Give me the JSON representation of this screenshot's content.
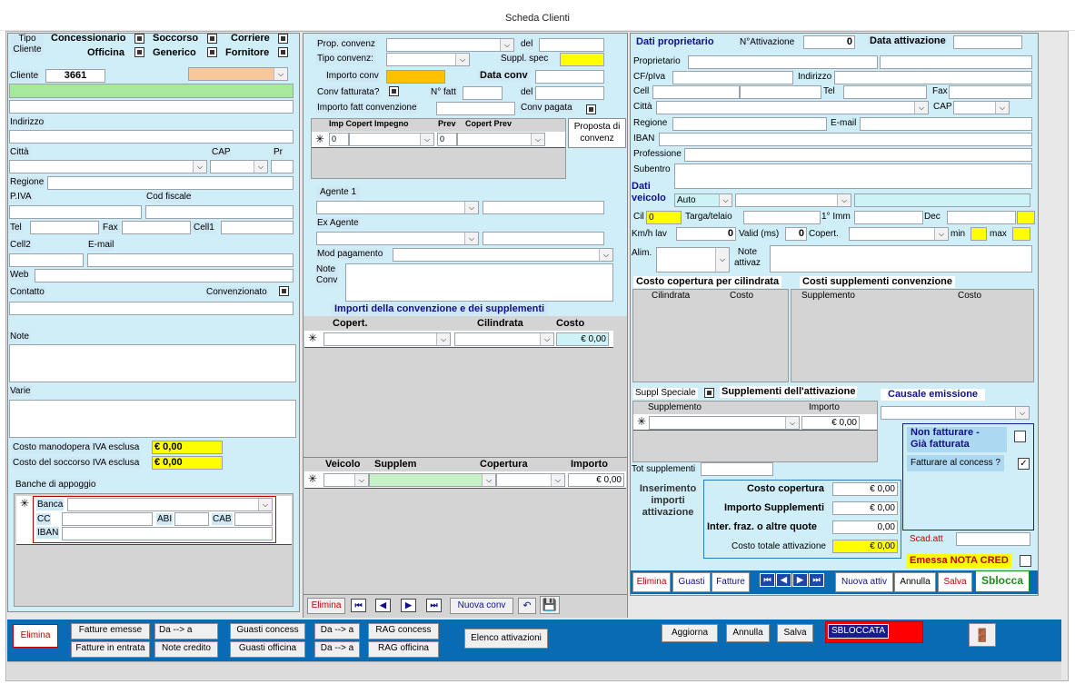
{
  "window": {
    "title": "Scheda Clienti"
  },
  "left": {
    "tipo_cliente_label": "Tipo\nCliente",
    "tipo_opts": [
      "Concessionario",
      "Soccorso",
      "Corriere",
      "Officina",
      "Generico",
      "Fornitore"
    ],
    "cliente_label": "Cliente",
    "cliente_value": "3661",
    "indirizzo": "Indirizzo",
    "citta": "Città",
    "cap": "CAP",
    "pr": "Pr",
    "regione": "Regione",
    "piva": "P.IVA",
    "cod_fiscale": "Cod fiscale",
    "tel": "Tel",
    "fax": "Fax",
    "cell1": "Cell1",
    "cell2": "Cell2",
    "email": "E-mail",
    "web": "Web",
    "contatto": "Contatto",
    "convenzionato": "Convenzionato",
    "note": "Note",
    "varie": "Varie",
    "costo_manodopera": "Costo manodopera IVA esclusa",
    "costo_manodopera_value": "€ 0,00",
    "costo_soccorso": "Costo del soccorso IVA esclusa",
    "costo_soccorso_value": "€ 0,00",
    "banche": "Banche di appoggio",
    "banca": "Banca",
    "cc": "CC",
    "abi": "ABI",
    "cab": "CAB",
    "iban": "IBAN",
    "new_row": "✳"
  },
  "middle": {
    "prop_convenz": "Prop. convenz",
    "del": "del",
    "tipo_convenz": "Tipo convenz:",
    "suppl_spec": "Suppl. spec",
    "importo_conv": "Importo conv",
    "data_conv": "Data conv",
    "conv_fatturata": "Conv fatturata?",
    "n_fatt": "N° fatt",
    "importo_fatt": "Importo fatt convenzione",
    "conv_pagata": "Conv pagata",
    "grid1_headers": [
      "Imp Copert Impegno",
      "Prev",
      "Copert Prev"
    ],
    "grid1_v1": "0",
    "grid1_v2": "0",
    "proposta": "Proposta di convenz",
    "agente1": "Agente 1",
    "ex_agente": "Ex Agente",
    "mod_pagamento": "Mod pagamento",
    "note_conv": "Note\nConv",
    "importi_title": "Importi della convenzione e dei supplementi",
    "grid2_headers": [
      "Copert.",
      "Cilindrata",
      "Costo"
    ],
    "grid2_costo": "€ 0,00",
    "grid3_headers": [
      "Veicolo",
      "Supplem",
      "Copertura",
      "Importo"
    ],
    "grid3_importo": "€ 0,00",
    "nav": {
      "elimina": "Elimina",
      "nuova_conv": "Nuova conv"
    }
  },
  "right": {
    "dati_proprietario": "Dati proprietario",
    "n_attivazione": "N°Attivazione",
    "n_attivazione_value": "0",
    "data_attivazione": "Data attivazione",
    "proprietario": "Proprietario",
    "cf_piva": "CF/pIva",
    "indirizzo": "Indirizzo",
    "cell": "Cell",
    "tel": "Tel",
    "fax": "Fax",
    "citta": "Città",
    "cap": "CAP",
    "regione": "Regione",
    "email": "E-mail",
    "iban": "IBAN",
    "professione": "Professione",
    "subentro": "Subentro",
    "dati_veicolo": "Dati\nveicolo",
    "tipo_veicolo": "Auto",
    "cil": "Cil",
    "cil_value": "0",
    "targa": "Targa/telaio",
    "imm": "1° Imm",
    "dec": "Dec",
    "kmh": "Km/h lav",
    "kmh_value": "0",
    "valid": "Valid (ms)",
    "valid_value": "0",
    "copert": "Copert.",
    "min": "min",
    "max": "max",
    "alim": "Alim.",
    "note_attivaz": "Note\nattivaz",
    "costo_cop_cil": "Costo copertura per cilindrata",
    "costi_suppl_conv": "Costi supplementi convenzione",
    "grid_cil_headers": [
      "Cilindrata",
      "Costo"
    ],
    "grid_supp_headers": [
      "Supplemento",
      "Costo"
    ],
    "suppl_speciale": "Suppl Speciale",
    "supplementi_attivazione": "Supplementi dell'attivazione",
    "causale_emissione": "Causale emissione",
    "grid_sa_headers": [
      "Supplemento",
      "Importo"
    ],
    "grid_sa_value": "€ 0,00",
    "non_fatturare": "Non fatturare -\nGià fatturata",
    "fatturare_concess": "Fatturare al concess ?",
    "tot_supplementi": "Tot supplementi",
    "inserimento": "Inserimento\nimporti\nattivazione",
    "costo_copertura": "Costo copertura",
    "costo_copertura_value": "€ 0,00",
    "importo_supplementi": "Importo Supplementi",
    "importo_supplementi_value": "€ 0,00",
    "inter_fraz": "Inter. fraz. o altre quote",
    "inter_fraz_value": "0,00",
    "costo_totale": "Costo totale attivazione",
    "costo_totale_value": "€ 0,00",
    "scad_att": "Scad.att",
    "emessa_nota": "Emessa NOTA CRED",
    "nav": {
      "elimina": "Elimina",
      "guasti": "Guasti",
      "fatture": "Fatture",
      "nuova_attiv": "Nuova attiv",
      "annulla": "Annulla",
      "salva": "Salva",
      "sblocca": "Sblocca"
    }
  },
  "bottom": {
    "elimina": "Elimina",
    "fatture_emesse": "Fatture emesse",
    "fatture_entrata": "Fatture in entrata",
    "da_a": "Da --> a",
    "note_credito": "Note credito",
    "guasti_concess": "Guasti concess",
    "guasti_officina": "Guasti officina",
    "rag_concess": "RAG concess",
    "rag_officina": "RAG officina",
    "elenco_attivazioni": "Elenco attivazioni",
    "aggiorna": "Aggiorna",
    "annulla": "Annulla",
    "salva": "Salva",
    "status": "SBLOCCATA"
  },
  "colors": {
    "panel": "#cfeef8",
    "lightcyan": "#ccf3f6",
    "grey": "#d4d4d4",
    "yellow": "#ffff00",
    "bottombar": "#0a6bb5",
    "orange": "#f8c89a",
    "green": "#a8e89a",
    "blue_label": "#10108a",
    "red": "#cc0000"
  }
}
